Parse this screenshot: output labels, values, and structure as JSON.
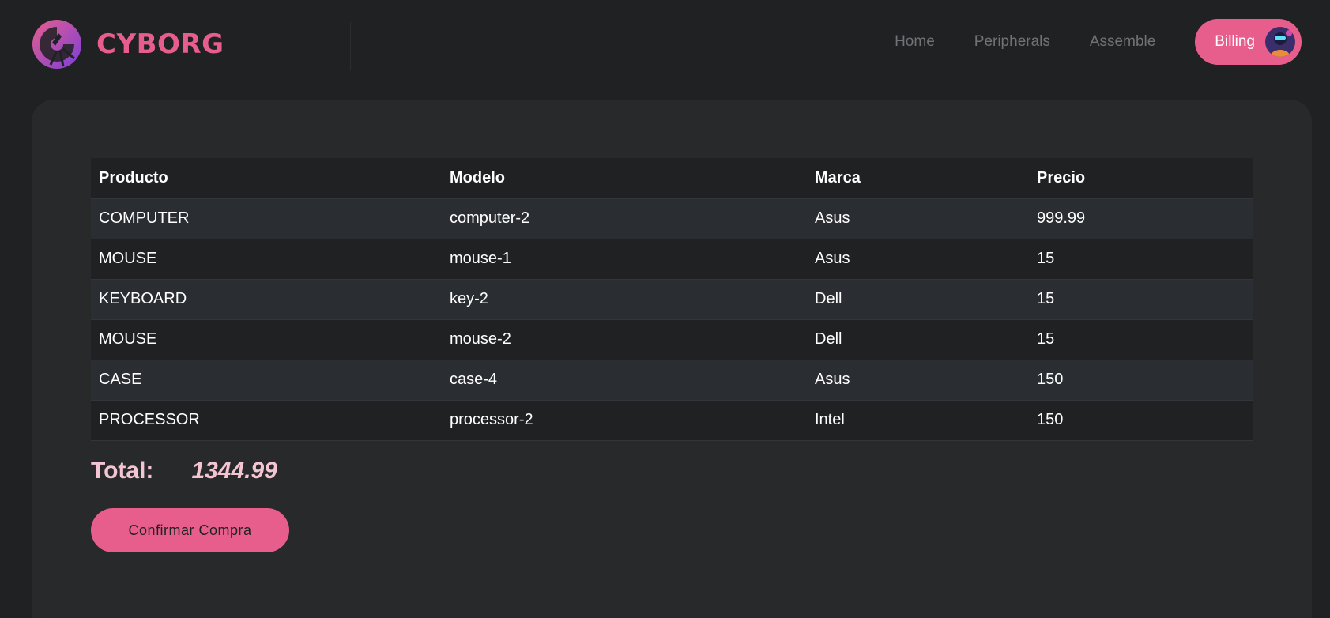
{
  "brand": {
    "name": "CYBORG",
    "accent": "#e75e8d"
  },
  "nav": {
    "items": [
      {
        "label": "Home"
      },
      {
        "label": "Peripherals"
      },
      {
        "label": "Assemble"
      }
    ],
    "billing_label": "Billing",
    "avatar_icon": "user-avatar"
  },
  "table": {
    "headers": [
      "Producto",
      "Modelo",
      "Marca",
      "Precio"
    ],
    "rows": [
      [
        "COMPUTER",
        "computer-2",
        "Asus",
        "999.99"
      ],
      [
        "MOUSE",
        "mouse-1",
        "Asus",
        "15"
      ],
      [
        "KEYBOARD",
        "key-2",
        "Dell",
        "15"
      ],
      [
        "MOUSE",
        "mouse-2",
        "Dell",
        "15"
      ],
      [
        "CASE",
        "case-4",
        "Asus",
        "150"
      ],
      [
        "PROCESSOR",
        "processor-2",
        "Intel",
        "150"
      ]
    ]
  },
  "total": {
    "label": "Total:",
    "value": "1344.99"
  },
  "confirm_button": "Confirmar Compra"
}
